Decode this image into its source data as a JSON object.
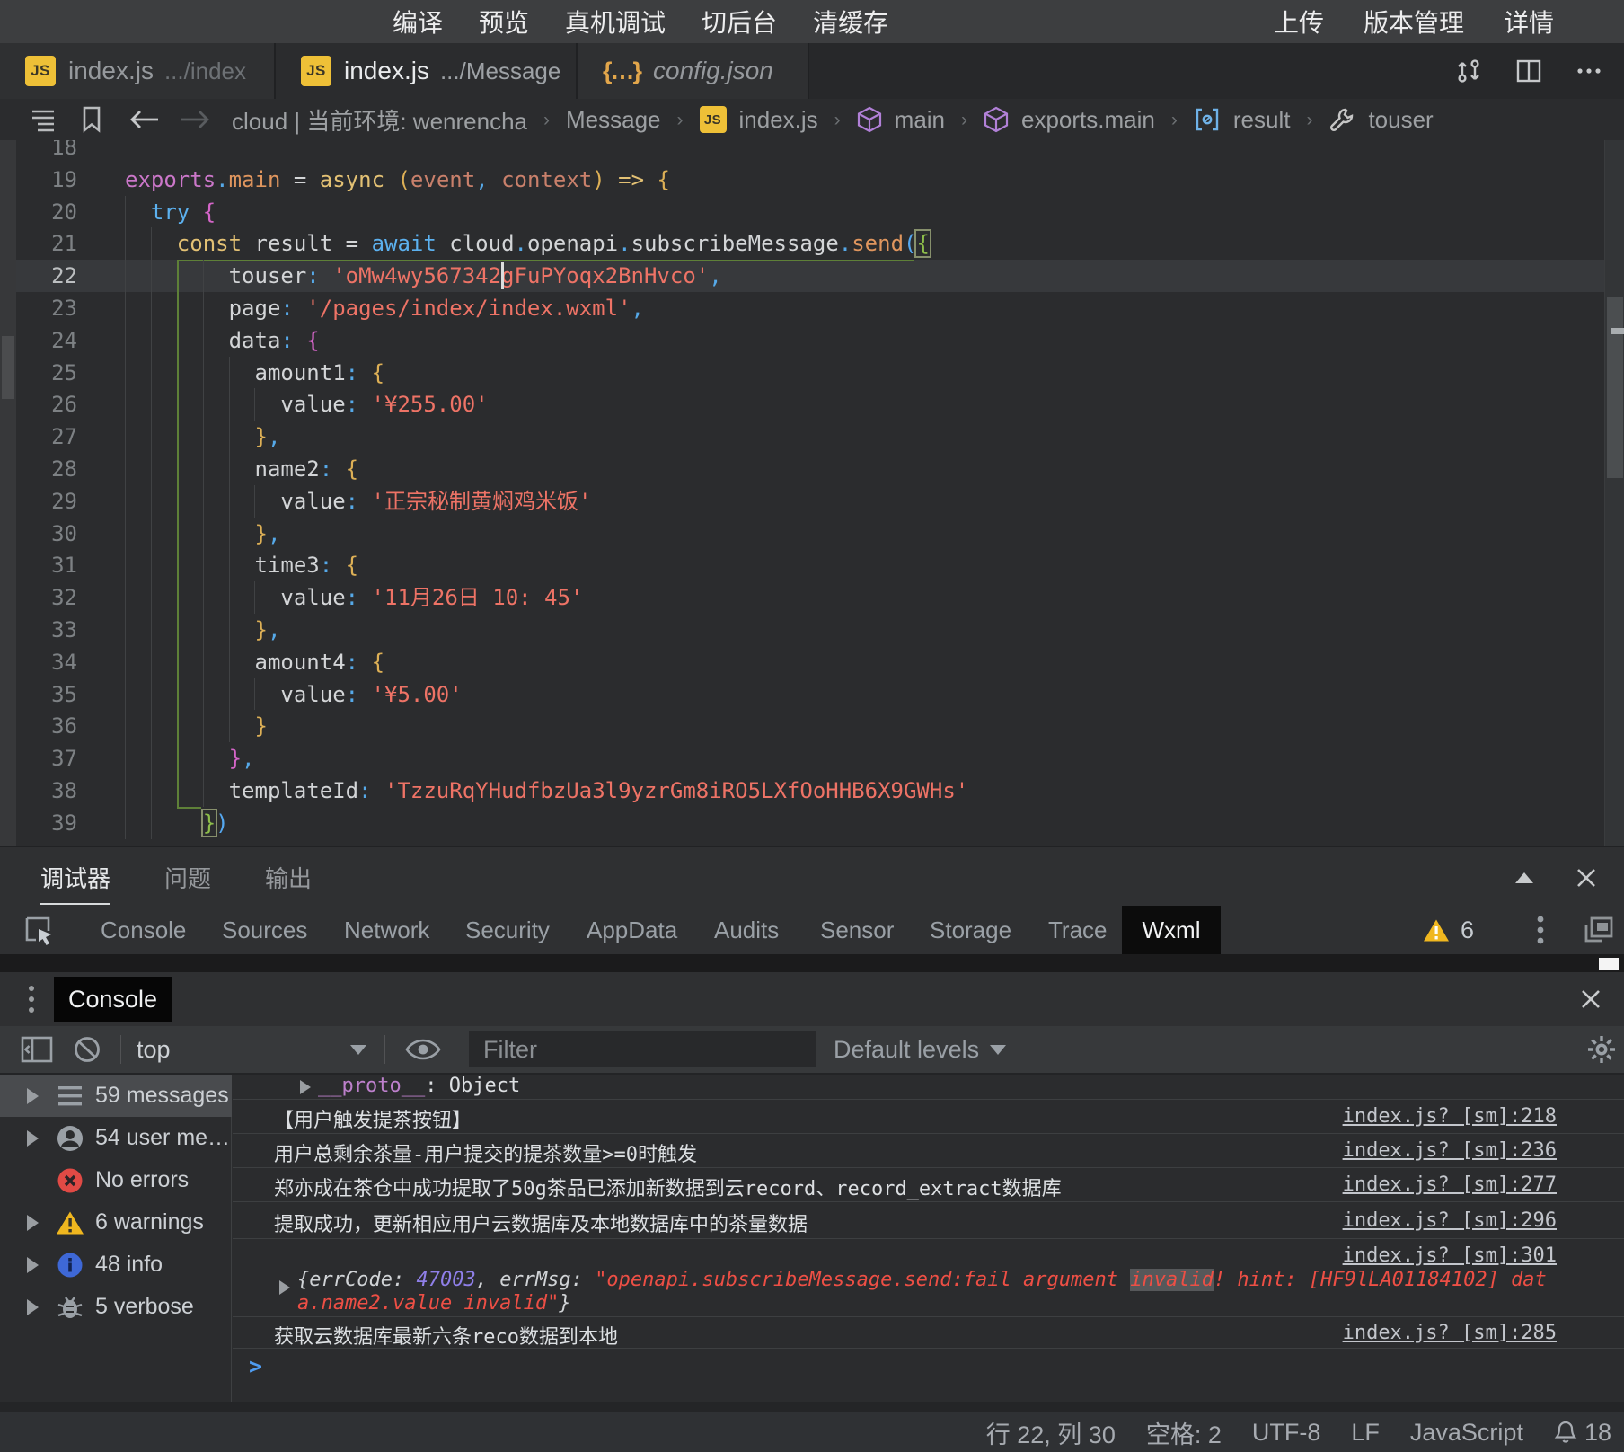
{
  "menu": {
    "left": [
      "编译",
      "预览",
      "真机调试",
      "切后台",
      "清缓存"
    ],
    "right": [
      "上传",
      "版本管理",
      "详情"
    ]
  },
  "tabs": [
    {
      "icon": "js",
      "name": "index.js",
      "path": ".../index",
      "state": "inactive",
      "modified": false
    },
    {
      "icon": "js",
      "name": "index.js",
      "path": ".../Message",
      "state": "active",
      "modified": true
    },
    {
      "icon": "json",
      "name": "config.json",
      "path": "",
      "state": "preview",
      "modified": false
    }
  ],
  "breadcrumb": [
    {
      "icon": "",
      "label": "cloud | 当前环境: wenrencha"
    },
    {
      "icon": "",
      "label": "Message"
    },
    {
      "icon": "js",
      "label": "index.js"
    },
    {
      "icon": "cube",
      "label": "main"
    },
    {
      "icon": "cube",
      "label": "exports.main"
    },
    {
      "icon": "array",
      "label": "result"
    },
    {
      "icon": "wrench",
      "label": "touser"
    }
  ],
  "editor": {
    "first_line": 18,
    "cursor": {
      "line": 22,
      "col": 29
    },
    "active_guide": {
      "col": 4,
      "from_line": 22,
      "to_line": 39
    },
    "lines": [
      {
        "n": 18,
        "tokens": []
      },
      {
        "n": 19,
        "tokens": [
          [
            "exports",
            "pink"
          ],
          [
            ".",
            "dot"
          ],
          [
            "main",
            "orange"
          ],
          [
            " = ",
            "w"
          ],
          [
            "async",
            "yellow"
          ],
          [
            " ",
            "w"
          ],
          [
            "(",
            "b1"
          ],
          [
            "event",
            "param"
          ],
          [
            ",",
            "dot"
          ],
          [
            " ",
            "w"
          ],
          [
            "context",
            "param"
          ],
          [
            ")",
            "b1"
          ],
          [
            " ",
            "w"
          ],
          [
            "=>",
            "yellow"
          ],
          [
            " ",
            "w"
          ],
          [
            "{",
            "b1"
          ]
        ]
      },
      {
        "n": 20,
        "tokens": [
          [
            "  ",
            "w"
          ],
          [
            "try",
            "blue"
          ],
          [
            " ",
            "w"
          ],
          [
            "{",
            "b2"
          ]
        ]
      },
      {
        "n": 21,
        "tokens": [
          [
            "    ",
            "w"
          ],
          [
            "const",
            "yellow"
          ],
          [
            " ",
            "w"
          ],
          [
            "result",
            "w"
          ],
          [
            " = ",
            "w"
          ],
          [
            "await",
            "blue"
          ],
          [
            " ",
            "w"
          ],
          [
            "cloud",
            "w"
          ],
          [
            ".",
            "dot"
          ],
          [
            "openapi",
            "w"
          ],
          [
            ".",
            "dot"
          ],
          [
            "subscribeMessage",
            "w"
          ],
          [
            ".",
            "dot"
          ],
          [
            "send",
            "orange"
          ],
          [
            "(",
            "b3"
          ],
          [
            "{",
            "match"
          ]
        ]
      },
      {
        "n": 22,
        "tokens": [
          [
            "        ",
            "w"
          ],
          [
            "touser",
            "w"
          ],
          [
            ":",
            "dot"
          ],
          [
            " ",
            "w"
          ],
          [
            "'oMw4wy567342gFuPYoqx2BnHvco'",
            "str"
          ],
          [
            ",",
            "dot"
          ]
        ]
      },
      {
        "n": 23,
        "tokens": [
          [
            "        ",
            "w"
          ],
          [
            "page",
            "w"
          ],
          [
            ":",
            "dot"
          ],
          [
            " ",
            "w"
          ],
          [
            "'/pages/index/index.wxml'",
            "str"
          ],
          [
            ",",
            "dot"
          ]
        ]
      },
      {
        "n": 24,
        "tokens": [
          [
            "        ",
            "w"
          ],
          [
            "data",
            "w"
          ],
          [
            ":",
            "dot"
          ],
          [
            " ",
            "w"
          ],
          [
            "{",
            "b5"
          ]
        ]
      },
      {
        "n": 25,
        "tokens": [
          [
            "          ",
            "w"
          ],
          [
            "amount1",
            "w"
          ],
          [
            ":",
            "dot"
          ],
          [
            " ",
            "w"
          ],
          [
            "{",
            "b6"
          ]
        ]
      },
      {
        "n": 26,
        "tokens": [
          [
            "            ",
            "w"
          ],
          [
            "value",
            "w"
          ],
          [
            ":",
            "dot"
          ],
          [
            " ",
            "w"
          ],
          [
            "'¥255.00'",
            "str"
          ]
        ]
      },
      {
        "n": 27,
        "tokens": [
          [
            "          ",
            "w"
          ],
          [
            "}",
            "b6"
          ],
          [
            ",",
            "dot"
          ]
        ]
      },
      {
        "n": 28,
        "tokens": [
          [
            "          ",
            "w"
          ],
          [
            "name2",
            "w"
          ],
          [
            ":",
            "dot"
          ],
          [
            " ",
            "w"
          ],
          [
            "{",
            "b6"
          ]
        ]
      },
      {
        "n": 29,
        "tokens": [
          [
            "            ",
            "w"
          ],
          [
            "value",
            "w"
          ],
          [
            ":",
            "dot"
          ],
          [
            " ",
            "w"
          ],
          [
            "'正宗秘制黄焖鸡米饭'",
            "str"
          ]
        ]
      },
      {
        "n": 30,
        "tokens": [
          [
            "          ",
            "w"
          ],
          [
            "}",
            "b6"
          ],
          [
            ",",
            "dot"
          ]
        ]
      },
      {
        "n": 31,
        "tokens": [
          [
            "          ",
            "w"
          ],
          [
            "time3",
            "w"
          ],
          [
            ":",
            "dot"
          ],
          [
            " ",
            "w"
          ],
          [
            "{",
            "b6"
          ]
        ]
      },
      {
        "n": 32,
        "tokens": [
          [
            "            ",
            "w"
          ],
          [
            "value",
            "w"
          ],
          [
            ":",
            "dot"
          ],
          [
            " ",
            "w"
          ],
          [
            "'11月26日 10: 45'",
            "str"
          ]
        ]
      },
      {
        "n": 33,
        "tokens": [
          [
            "          ",
            "w"
          ],
          [
            "}",
            "b6"
          ],
          [
            ",",
            "dot"
          ]
        ]
      },
      {
        "n": 34,
        "tokens": [
          [
            "          ",
            "w"
          ],
          [
            "amount4",
            "w"
          ],
          [
            ":",
            "dot"
          ],
          [
            " ",
            "w"
          ],
          [
            "{",
            "b6"
          ]
        ]
      },
      {
        "n": 35,
        "tokens": [
          [
            "            ",
            "w"
          ],
          [
            "value",
            "w"
          ],
          [
            ":",
            "dot"
          ],
          [
            " ",
            "w"
          ],
          [
            "'¥5.00'",
            "str"
          ]
        ]
      },
      {
        "n": 36,
        "tokens": [
          [
            "          ",
            "w"
          ],
          [
            "}",
            "b6"
          ]
        ]
      },
      {
        "n": 37,
        "tokens": [
          [
            "        ",
            "w"
          ],
          [
            "}",
            "b5"
          ],
          [
            ",",
            "dot"
          ]
        ]
      },
      {
        "n": 38,
        "tokens": [
          [
            "        ",
            "w"
          ],
          [
            "templateId",
            "w"
          ],
          [
            ":",
            "dot"
          ],
          [
            " ",
            "w"
          ],
          [
            "'TzzuRqYHudfbzUa3l9yzrGm8iRO5LXfOoHHB6X9GWHs'",
            "str"
          ]
        ]
      },
      {
        "n": 39,
        "tokens": [
          [
            "      ",
            "w"
          ],
          [
            "}",
            "match"
          ],
          [
            ")",
            "b3"
          ]
        ]
      }
    ]
  },
  "debugger_panel": {
    "tabs": [
      "调试器",
      "问题",
      "输出"
    ],
    "active": "调试器"
  },
  "devtools": {
    "tabs": [
      "Console",
      "Sources",
      "Network",
      "Security",
      "AppData",
      "Audits",
      "Sensor",
      "Storage",
      "Trace",
      "Wxml"
    ],
    "active": "Wxml",
    "warning_count": "6"
  },
  "drawer": {
    "tab": "Console"
  },
  "console": {
    "context": "top",
    "filter_placeholder": "Filter",
    "levels": "Default levels",
    "sidebar": [
      {
        "icon": "list",
        "label": "59 messages",
        "selected": true,
        "arrow": true
      },
      {
        "icon": "user",
        "label": "54 user me…",
        "selected": false,
        "arrow": true
      },
      {
        "icon": "error",
        "label": "No errors",
        "selected": false,
        "arrow": false
      },
      {
        "icon": "warning",
        "label": "6 warnings",
        "selected": false,
        "arrow": true
      },
      {
        "icon": "info",
        "label": "48 info",
        "selected": false,
        "arrow": true
      },
      {
        "icon": "verbose",
        "label": "5 verbose",
        "selected": false,
        "arrow": true
      }
    ],
    "messages": [
      {
        "type": "proto",
        "key": "__proto__",
        "sep": ": ",
        "value": "Object"
      },
      {
        "type": "log",
        "text": "【用户触发提茶按钮】",
        "link": "index.js? [sm]:218"
      },
      {
        "type": "log",
        "text": "用户总剩余茶量-用户提交的提茶数量>=0时触发",
        "link": "index.js? [sm]:236"
      },
      {
        "type": "log",
        "text": "郑亦成在茶仓中成功提取了50g茶品已添加新数据到云record、record_extract数据库",
        "link": "index.js? [sm]:277"
      },
      {
        "type": "log",
        "text": "提取成功，更新相应用户云数据库及本地数据库中的茶量数据",
        "link": "index.js? [sm]:296"
      },
      {
        "type": "errobj",
        "link": "index.js? [sm]:301",
        "line1": [
          {
            "t": "{",
            "c": "obj"
          },
          {
            "t": "errCode",
            "c": "obj"
          },
          {
            "t": ": ",
            "c": "obj"
          },
          {
            "t": "47003",
            "c": "num"
          },
          {
            "t": ", ",
            "c": "obj"
          },
          {
            "t": "errMsg",
            "c": "obj"
          },
          {
            "t": ": ",
            "c": "obj"
          },
          {
            "t": "\"openapi.subscribeMessage.send:fail argument ",
            "c": "err"
          },
          {
            "t": "invalid",
            "c": "err hl"
          },
          {
            "t": "! hint: [HF9lLA01184102] dat",
            "c": "err"
          }
        ],
        "line2": [
          {
            "t": "a.name2.value invalid\"",
            "c": "err"
          },
          {
            "t": "}",
            "c": "obj"
          }
        ]
      },
      {
        "type": "log",
        "text": "获取云数据库最新六条reco数据到本地",
        "link": "index.js? [sm]:285"
      },
      {
        "type": "prompt",
        "symbol": ">"
      }
    ]
  },
  "statusbar": {
    "items": [
      "行 22, 列 30",
      "空格: 2",
      "UTF-8",
      "LF",
      "JavaScript"
    ],
    "notifications": "18"
  }
}
